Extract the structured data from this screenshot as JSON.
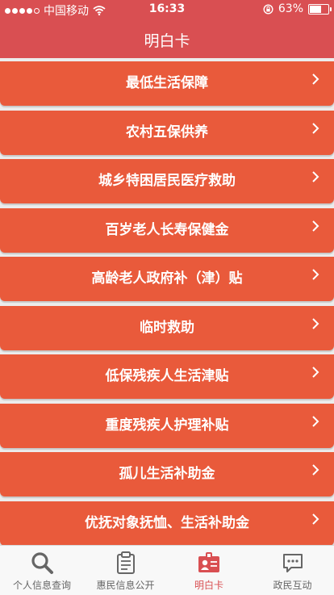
{
  "status": {
    "carrier": "中国移动",
    "time": "16:33",
    "battery": "63%",
    "battery_level": 0.63
  },
  "header": {
    "title": "明白卡"
  },
  "menu": [
    {
      "label": "最低生活保障"
    },
    {
      "label": "农村五保供养"
    },
    {
      "label": "城乡特困居民医疗救助"
    },
    {
      "label": "百岁老人长寿保健金"
    },
    {
      "label": "高龄老人政府补（津）贴"
    },
    {
      "label": "临时救助"
    },
    {
      "label": "低保残疾人生活津贴"
    },
    {
      "label": "重度残疾人护理补贴"
    },
    {
      "label": "孤儿生活补助金"
    },
    {
      "label": "优抚对象抚恤、生活补助金"
    }
  ],
  "tabs": [
    {
      "label": "个人信息查询",
      "icon": "search-icon"
    },
    {
      "label": "惠民信息公开",
      "icon": "clipboard-icon"
    },
    {
      "label": "明白卡",
      "icon": "id-card-icon",
      "active": true
    },
    {
      "label": "政民互动",
      "icon": "chat-icon"
    }
  ],
  "colors": {
    "header": "#d94f52",
    "row": "#e95a3b",
    "tab_active": "#d94f52",
    "tab_inactive": "#666666"
  }
}
